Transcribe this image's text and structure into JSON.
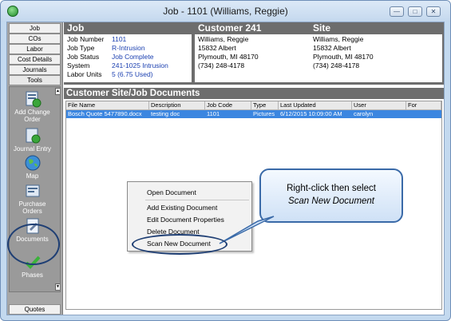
{
  "window": {
    "title": "Job - 1101 (Williams, Reggie)"
  },
  "sidebar": {
    "tabs": [
      {
        "label": "Job"
      },
      {
        "label": "COs"
      },
      {
        "label": "Labor"
      },
      {
        "label": "Cost Details"
      },
      {
        "label": "Journals"
      },
      {
        "label": "Tools"
      }
    ],
    "tools": [
      {
        "label": "Add Change Order",
        "icon": "add-change-order-icon"
      },
      {
        "label": "Journal Entry",
        "icon": "journal-entry-icon"
      },
      {
        "label": "Map",
        "icon": "globe-icon"
      },
      {
        "label": "Purchase Orders",
        "icon": "purchase-order-icon"
      },
      {
        "label": "Documents",
        "icon": "documents-icon"
      },
      {
        "label": "Phases",
        "icon": "checkmark-icon"
      }
    ],
    "bottom_tab": "Quotes"
  },
  "job": {
    "heading": "Job",
    "fields": [
      {
        "label": "Job Number",
        "value": "1101"
      },
      {
        "label": "Job Type",
        "value": "R-Intrusion"
      },
      {
        "label": "Job Status",
        "value": "Job Complete"
      },
      {
        "label": "System",
        "value": "241-1025 Intrusion"
      },
      {
        "label": "Labor Units",
        "value": "5 (6.75 Used)"
      }
    ]
  },
  "customer": {
    "heading": "Customer 241",
    "lines": [
      "Williams, Reggie",
      "15832 Albert",
      "Plymouth, MI 48170",
      "(734) 248-4178"
    ]
  },
  "site": {
    "heading": "Site",
    "lines": [
      "Williams, Reggie",
      "15832 Albert",
      "Plymouth, MI 48170",
      "(734) 248-4178"
    ]
  },
  "documents": {
    "heading": "Customer Site/Job Documents",
    "columns": [
      "File Name",
      "Description",
      "Job Code",
      "Type",
      "Last Updated",
      "User",
      "For"
    ],
    "rows": [
      [
        "Bosch Quote 5477890.docx",
        "testing doc",
        "1101",
        "Pictures",
        "6/12/2015 10:09:00 AM",
        "carolyn",
        ""
      ]
    ]
  },
  "context_menu": {
    "items": [
      "Open Document",
      "Add Existing Document",
      "Edit Document Properties",
      "Delete Document",
      "Scan New Document"
    ]
  },
  "callout": {
    "line1": "Right-click then select",
    "line2": "Scan New Document"
  },
  "colors": {
    "header_bg": "#6d6d6d",
    "selection": "#3b86e0",
    "link_value": "#1a3fb0",
    "highlight_ring": "#1f3f74"
  }
}
